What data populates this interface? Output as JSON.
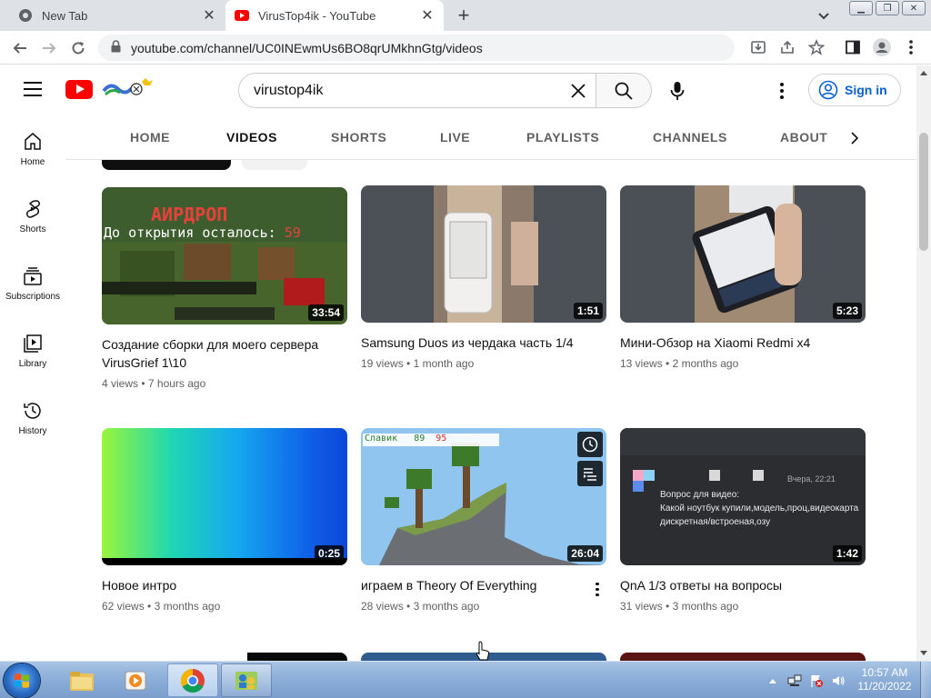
{
  "browser": {
    "tabs": [
      {
        "title": "New Tab",
        "active": false
      },
      {
        "title": "VirusTop4ik - YouTube",
        "active": true
      }
    ],
    "address": "youtube.com/channel/UC0INEwmUs6BO8qrUMkhnGtg/videos"
  },
  "youtube": {
    "search_query": "virustop4ik",
    "sign_in_label": "Sign in",
    "guide": [
      {
        "label": "Home",
        "icon": "home-icon"
      },
      {
        "label": "Shorts",
        "icon": "shorts-icon"
      },
      {
        "label": "Subscriptions",
        "icon": "subscriptions-icon"
      },
      {
        "label": "Library",
        "icon": "library-icon"
      },
      {
        "label": "History",
        "icon": "history-icon"
      }
    ],
    "channel_tabs": [
      {
        "label": "HOME"
      },
      {
        "label": "VIDEOS",
        "selected": true
      },
      {
        "label": "SHORTS"
      },
      {
        "label": "LIVE"
      },
      {
        "label": "PLAYLISTS"
      },
      {
        "label": "CHANNELS"
      },
      {
        "label": "ABOUT"
      }
    ],
    "videos": [
      {
        "title": "Создание сборки для моего сервера VirusGrief 1\\10",
        "views": "4 views",
        "age": "7 hours ago",
        "duration": "33:54",
        "thumb_text_1": "АИРДРОП",
        "thumb_text_2": "До открытия осталось:",
        "thumb_counter": "59"
      },
      {
        "title": "Samsung Duos из чердака часть 1/4",
        "views": "19 views",
        "age": "1 month ago",
        "duration": "1:51"
      },
      {
        "title": "Мини-Обзор на Xiaomi Redmi x4",
        "views": "13 views",
        "age": "2 months ago",
        "duration": "5:23"
      },
      {
        "title": "Новое интро",
        "views": "62 views",
        "age": "3 months ago",
        "duration": "0:25"
      },
      {
        "title": "играем в Theory Of Everything",
        "views": "28 views",
        "age": "3 months ago",
        "duration": "26:04",
        "thumb_player": "Славик",
        "thumb_num_1": "89",
        "thumb_num_2": "95"
      },
      {
        "title": "QnA 1/3 ответы на вопросы",
        "views": "31 views",
        "age": "3 months ago",
        "duration": "1:42",
        "thumb_time": "Вчера, 22:21",
        "thumb_line_1": "Вопрос для видео:",
        "thumb_line_2": "Какой ноутбук купили,модель,проц,видеокарта",
        "thumb_line_3": "дискретная/встроеная,озу"
      }
    ]
  },
  "taskbar": {
    "time": "10:57 AM",
    "date": "11/20/2022"
  },
  "colors": {
    "youtube_red": "#ff0000",
    "link_blue": "#065fd4",
    "taskbar_blue": "#8fb1da"
  }
}
